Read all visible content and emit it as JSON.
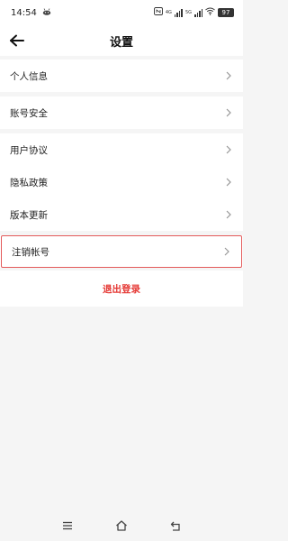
{
  "status_bar": {
    "time": "14:54",
    "network_label_1": "4G",
    "network_label_2": "5G",
    "battery": "97"
  },
  "header": {
    "title": "设置"
  },
  "groups": [
    {
      "items": [
        {
          "label": "个人信息"
        }
      ]
    },
    {
      "items": [
        {
          "label": "账号安全"
        }
      ]
    },
    {
      "items": [
        {
          "label": "用户协议"
        },
        {
          "label": "隐私政策"
        },
        {
          "label": "版本更新"
        }
      ]
    },
    {
      "items": [
        {
          "label": "注销帐号",
          "highlighted": true
        }
      ]
    }
  ],
  "logout": {
    "label": "退出登录"
  },
  "colors": {
    "accent": "#e53935",
    "highlight_border": "#e35a5a",
    "background": "#f5f5f5"
  },
  "icons": {
    "back": "arrow-left-icon",
    "chevron": "chevron-right-icon",
    "nav_menu": "menu-icon",
    "nav_home": "home-icon",
    "nav_back": "return-icon"
  }
}
